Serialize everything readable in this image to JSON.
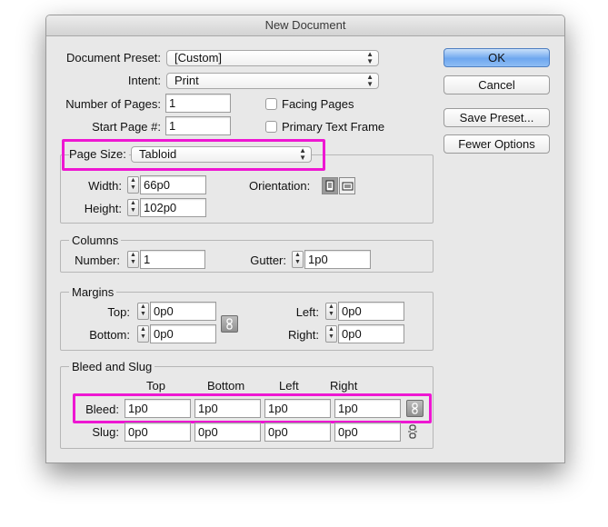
{
  "window": {
    "title": "New Document"
  },
  "document_preset": {
    "label": "Document Preset:",
    "value": "[Custom]"
  },
  "intent": {
    "label": "Intent:",
    "value": "Print"
  },
  "number_of_pages": {
    "label": "Number of Pages:",
    "value": "1"
  },
  "start_page": {
    "label": "Start Page #:",
    "value": "1"
  },
  "facing_pages": {
    "label": "Facing Pages",
    "checked": false
  },
  "primary_text_frame": {
    "label": "Primary Text Frame",
    "checked": false
  },
  "page_size": {
    "label": "Page Size:",
    "value": "Tabloid",
    "width_label": "Width:",
    "width": "66p0",
    "height_label": "Height:",
    "height": "102p0",
    "orientation_label": "Orientation:"
  },
  "columns": {
    "title": "Columns",
    "number_label": "Number:",
    "number": "1",
    "gutter_label": "Gutter:",
    "gutter": "1p0"
  },
  "margins": {
    "title": "Margins",
    "top_label": "Top:",
    "top": "0p0",
    "bottom_label": "Bottom:",
    "bottom": "0p0",
    "left_label": "Left:",
    "left": "0p0",
    "right_label": "Right:",
    "right": "0p0"
  },
  "bleed_slug": {
    "title": "Bleed and Slug",
    "headers": [
      "Top",
      "Bottom",
      "Left",
      "Right"
    ],
    "bleed_label": "Bleed:",
    "bleed": [
      "1p0",
      "1p0",
      "1p0",
      "1p0"
    ],
    "slug_label": "Slug:",
    "slug": [
      "0p0",
      "0p0",
      "0p0",
      "0p0"
    ]
  },
  "buttons": {
    "ok": "OK",
    "cancel": "Cancel",
    "save_preset": "Save Preset...",
    "fewer_options": "Fewer Options"
  },
  "colors": {
    "highlight": "#ee17d2",
    "primary_button": "#6ea7ef"
  }
}
